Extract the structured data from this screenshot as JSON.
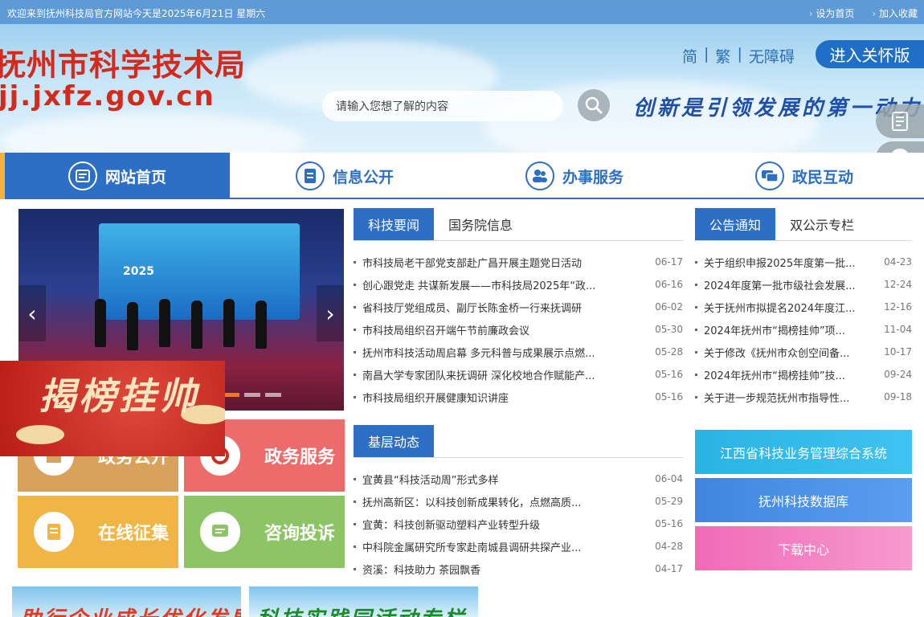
{
  "topbar": {
    "welcome": "欢迎来到抚州科技局官方网站今天是2025年6月21日 星期六",
    "set_home": "设为首页",
    "add_favorite": "加入收藏"
  },
  "header": {
    "logo_cn": "抚州市科学技术局",
    "logo_url": "jj.jxfz.gov.cn",
    "lang_simplified": "简",
    "lang_traditional": "繁",
    "accessibility": "无障碍",
    "care_button": "进入关怀版",
    "search_placeholder": "请输入您想了解的内容",
    "slogan": "创新是引领发展的第一动力"
  },
  "nav": {
    "items": [
      {
        "label": "网站首页",
        "icon": "home-icon"
      },
      {
        "label": "信息公开",
        "icon": "document-icon"
      },
      {
        "label": "办事服务",
        "icon": "people-icon"
      },
      {
        "label": "政民互动",
        "icon": "chat-icon"
      }
    ]
  },
  "slider": {
    "screen_text": "2025"
  },
  "popup": {
    "text": "揭榜挂帅"
  },
  "tiles": [
    {
      "label": "政务公开",
      "color": "#d9a25c"
    },
    {
      "label": "政务服务",
      "color": "#ee6b6b"
    },
    {
      "label": "在线征集",
      "color": "#f0b545"
    },
    {
      "label": "咨询投诉",
      "color": "#8cc466"
    }
  ],
  "news": {
    "tabs": [
      "科技要闻",
      "国务院信息"
    ],
    "items": [
      {
        "title": "市科技局老干部党支部赴广昌开展主题党日活动",
        "date": "06-17"
      },
      {
        "title": "创心跟党走 共谋新发展——市科技局2025年“政...",
        "date": "06-16"
      },
      {
        "title": "省科技厅党组成员、副厅长陈金桥一行来抚调研",
        "date": "06-02"
      },
      {
        "title": "市科技局组织召开端午节前廉政会议",
        "date": "05-30"
      },
      {
        "title": "抚州市科技活动周启幕 多元科普与成果展示点燃...",
        "date": "05-28"
      },
      {
        "title": "南昌大学专家团队来抚调研 深化校地合作赋能产...",
        "date": "05-16"
      },
      {
        "title": "市科技局组织开展健康知识讲座",
        "date": "05-16"
      }
    ]
  },
  "notice": {
    "tabs": [
      "公告通知",
      "双公示专栏"
    ],
    "items": [
      {
        "title": "关于组织申报2025年度第一批...",
        "date": "04-23"
      },
      {
        "title": "2024年度第一批市级社会发展...",
        "date": "12-24"
      },
      {
        "title": "关于抚州市拟提名2024年度江...",
        "date": "12-16"
      },
      {
        "title": "2024年抚州市“揭榜挂帅”项...",
        "date": "11-04"
      },
      {
        "title": "关于修改《抚州市众创空间备...",
        "date": "10-17"
      },
      {
        "title": "2024年抚州市“揭榜挂帅”技...",
        "date": "09-24"
      },
      {
        "title": "关于进一步规范抚州市指导性...",
        "date": "09-18"
      }
    ]
  },
  "grassroots": {
    "tabs": [
      "基层动态"
    ],
    "items": [
      {
        "title": "宜黄县“科技活动周”形式多样",
        "date": "06-04"
      },
      {
        "title": "抚州高新区：以科技创新成果转化，点燃高质...",
        "date": "05-29"
      },
      {
        "title": "宜黄：科技创新驱动塑料产业转型升级",
        "date": "05-16"
      },
      {
        "title": "中科院金属研究所专家赴南城县调研共探产业...",
        "date": "04-28"
      },
      {
        "title": "资溪：科技助力 茶园飘香",
        "date": "04-17"
      }
    ]
  },
  "systems": [
    {
      "label": "江西省科技业务管理综合系统",
      "color": "#2fb8e6"
    },
    {
      "label": "抚州科技数据库",
      "color": "#4a90e2"
    },
    {
      "label": "下载中心",
      "color": "#f07ec0"
    }
  ],
  "banners": [
    {
      "text": "助行企业成长优化发展环境"
    },
    {
      "text": "科技实践园活动专栏"
    }
  ]
}
